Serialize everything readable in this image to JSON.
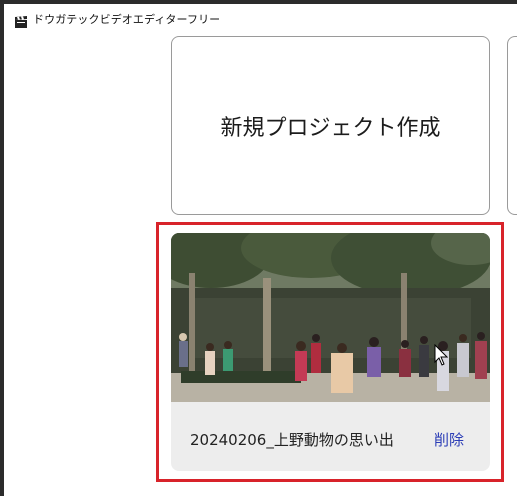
{
  "window": {
    "title": "ドウガテックビデオエディターフリー",
    "app_icon": "clapperboard-icon"
  },
  "cards": {
    "new_project_label": "新規プロジェクト作成"
  },
  "projects": [
    {
      "name": "20240206_上野動物の思い出",
      "delete_label": "削除",
      "thumbnail": "zoo-crowd-under-trees-photo"
    }
  ],
  "colors": {
    "highlight": "#d8232a",
    "delete_link": "#2b3db6",
    "card_background": "#ededed"
  }
}
